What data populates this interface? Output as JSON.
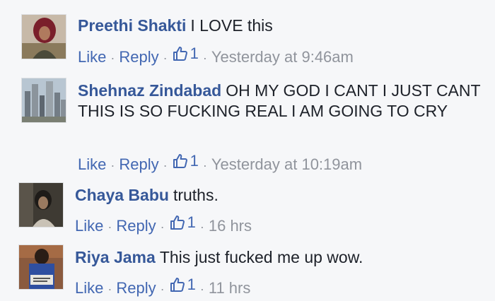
{
  "comments": [
    {
      "author": "Preethi Shakti",
      "text": "I LOVE this",
      "like_label": "Like",
      "reply_label": "Reply",
      "like_count": "1",
      "time": "Yesterday at 9:46am"
    },
    {
      "author": "Shehnaz Zindabad",
      "text": "OH MY GOD I CANT I JUST CANT THIS IS SO FUCKING REAL I AM GOING TO CRY",
      "like_label": "Like",
      "reply_label": "Reply",
      "like_count": "1",
      "time": "Yesterday at 10:19am"
    },
    {
      "author": "Chaya Babu",
      "text": "truths.",
      "like_label": "Like",
      "reply_label": "Reply",
      "like_count": "1",
      "time": "16 hrs"
    },
    {
      "author": "Riya Jama",
      "text": "This just fucked me up wow.",
      "like_label": "Like",
      "reply_label": "Reply",
      "like_count": "1",
      "time": "11 hrs"
    }
  ],
  "colors": {
    "author": "#365899",
    "link": "#4267b2",
    "meta": "#90949c",
    "background": "#f6f7f9"
  },
  "icons": {
    "like_icon": "thumbs-up-outline-icon",
    "separator": "·"
  }
}
